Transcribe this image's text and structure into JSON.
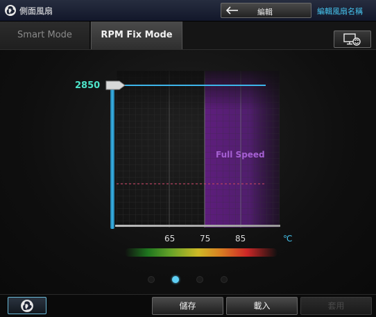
{
  "window": {
    "title": "側面風扇",
    "back_label": "編輯",
    "edit_fan_name": "編輯風扇名稱"
  },
  "tabs": [
    {
      "label": "Smart Mode",
      "selected": false
    },
    {
      "label": "RPM Fix Mode",
      "selected": true
    }
  ],
  "chart": {
    "rpm_value": "2850",
    "full_speed_label": "Full Speed",
    "temperature_ticks": [
      "65",
      "75",
      "85"
    ],
    "unit": "℃"
  },
  "pager": {
    "pages": 4,
    "active_index": 1
  },
  "footer": {
    "save_label": "儲存",
    "load_label": "載入",
    "apply_label": "套用",
    "apply_enabled": false
  },
  "colors": {
    "accent_blue": "#46c4ee",
    "rpm_green": "#4de3c8",
    "full_speed_purple": "#a560d2"
  }
}
